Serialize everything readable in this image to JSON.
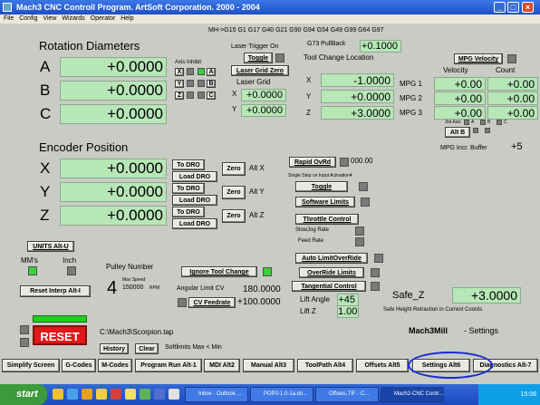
{
  "window": {
    "title": "Mach3 CNC Controll Program.  ArtSoft Corporation.  2000 - 2004"
  },
  "menu": [
    "File",
    "Config",
    "View",
    "Wizards",
    "Operator",
    "Help"
  ],
  "modal_line": "MH->G15  G1 G17 G40 G21 G90 G94 G54 G49 G99 G64 G97",
  "rotation": {
    "title": "Rotation Diameters",
    "axes": [
      {
        "label": "A",
        "value": "+0.0000"
      },
      {
        "label": "B",
        "value": "+0.0000"
      },
      {
        "label": "C",
        "value": "+0.0000"
      }
    ],
    "axis_inhibit_label": "Axis Inhibit",
    "inhibit_rows": [
      {
        "left": "X",
        "right": "A"
      },
      {
        "left": "Y",
        "right": "B"
      },
      {
        "left": "Z",
        "right": "C"
      }
    ]
  },
  "laser": {
    "trigger_label": "Laser Trigger On",
    "toggle_label": "Toggle",
    "grid_zero_label": "Laser Grid Zero",
    "grid_label": "Laser Grid",
    "x_label": "X",
    "x_value": "+0.0000",
    "y_label": "Y",
    "y_value": "+0.0000"
  },
  "g73": {
    "label": "G73 PullBack",
    "value": "+0.1000"
  },
  "tool_change": {
    "title": "Tool Change Location",
    "rows": [
      {
        "label": "X",
        "value": "-1.0000"
      },
      {
        "label": "Y",
        "value": "+0.0000"
      },
      {
        "label": "Z",
        "value": "+3.0000"
      }
    ]
  },
  "mpg": {
    "velocity_button": "MPG Velocity",
    "velocity_header": "Velocity",
    "count_header": "Count",
    "rows": [
      {
        "label": "MPG 1",
        "velocity": "+0.00",
        "count": "+0.00"
      },
      {
        "label": "MPG 2",
        "velocity": "+0.00",
        "count": "+0.00"
      },
      {
        "label": "MPG 3",
        "velocity": "+0.00",
        "count": "+0.00"
      }
    ],
    "axis_small": [
      "3rd Axis",
      "A",
      "B",
      "C"
    ],
    "alt_b_label": "Alt B",
    "incr_buffer_label": "MPG Incr. Buffer",
    "incr_buffer_value": "+5"
  },
  "encoder": {
    "title": "Encoder Position",
    "rows": [
      {
        "label": "X",
        "value": "+0.0000",
        "to_dro": "To DRO",
        "load_dro": "Load DRO",
        "zero": "Zero",
        "alt": "Alt X"
      },
      {
        "label": "Y",
        "value": "+0.0000",
        "to_dro": "To DRO",
        "load_dro": "Load DRO",
        "zero": "Zero",
        "alt": "Alt Y"
      },
      {
        "label": "Z",
        "value": "+0.0000",
        "to_dro": "To DRO",
        "load_dro": "Load DRO",
        "zero": "Zero",
        "alt": "Alt Z"
      }
    ]
  },
  "controls": {
    "rapid_ovrd_label": "Rapid OvRd",
    "rapid_ovrd_value": "000.00",
    "single_step_label": "Single Step on Input Activation4",
    "toggle2_label": "Toggle",
    "software_limits_label": "Software Limits",
    "throttle_label": "Throttle Control",
    "slow_jog_label": "SlowJog Rate",
    "feed_rate_label": "Feed Rate",
    "auto_limit_label": "Auto LimitOverRide",
    "override_limits_label": "OverRide Limits",
    "tangential_label": "Tangential Control",
    "lift_angle_label": "Lift Angle",
    "lift_angle_value": "+45",
    "lift_z_label": "Lift Z",
    "lift_z_value": "1.00"
  },
  "units": {
    "button": "UNITS Alt-U",
    "mm_label": "MM's",
    "inch_label": "Inch"
  },
  "reset_interp_label": "Reset Interp Alt-I",
  "pulley": {
    "title": "Pulley Number",
    "value": "4",
    "max_speed_label": "Max Speed",
    "max_speed_value": "150000",
    "rpm_label": "RPM"
  },
  "ignore_tool_change_label": "Ignore Tool Change",
  "angular_limit": {
    "label": "Angular Limit CV",
    "value": "180.0000"
  },
  "cv_feedrate": {
    "label": "CV Feedrate",
    "value": "+100.0000"
  },
  "safe_z": {
    "label": "Safe_Z",
    "value": "+3.0000",
    "note": "Safe Height Retraction in Current Coords"
  },
  "product": {
    "name": "Mach3Mill",
    "page": "- Settings"
  },
  "file_path": "C:\\Mach3\\Scorpion.tap",
  "reset_label": "RESET",
  "history_label": "History",
  "clear_label": "Clear",
  "softlimits_note": "Softlimits Max < Min",
  "tabs": [
    "Simplify Screen",
    "G-Codes",
    "M-Codes",
    "Program Run Alt-1",
    "MDI Alt2",
    "Manual Alt3",
    "ToolPath Alt4",
    "Offsets Alt5",
    "Settings Alt6",
    "Diagnostics Alt-7"
  ],
  "taskbar": {
    "start": "start",
    "tasks": [
      "Inbox - Outlook ...",
      "POP0-1.0-1a.do...",
      "Offsets.TIF - C...",
      "Mach2-CNC Contr..."
    ],
    "clock": "15:06"
  }
}
